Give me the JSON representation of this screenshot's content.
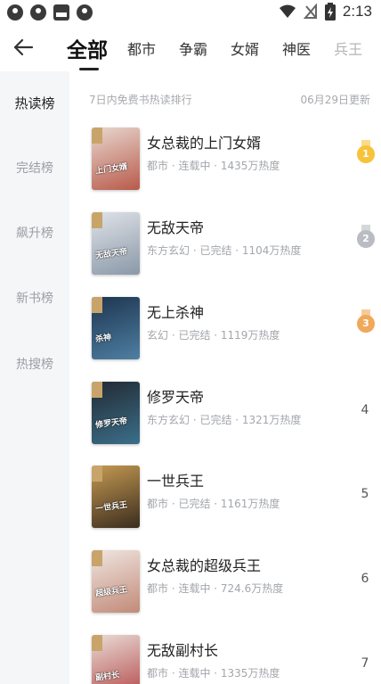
{
  "status_bar": {
    "time": "2:13"
  },
  "header": {
    "tabs": [
      {
        "label": "全部",
        "active": true
      },
      {
        "label": "都市"
      },
      {
        "label": "争霸"
      },
      {
        "label": "女婿"
      },
      {
        "label": "神医"
      },
      {
        "label": "兵王",
        "faded": true
      }
    ]
  },
  "sidebar": {
    "items": [
      {
        "label": "热读榜",
        "active": true
      },
      {
        "label": "完结榜"
      },
      {
        "label": "飙升榜"
      },
      {
        "label": "新书榜"
      },
      {
        "label": "热搜榜"
      }
    ]
  },
  "list": {
    "subtitle": "7日内免费书热读排行",
    "updated": "06月29日更新",
    "books": [
      {
        "title": "女总裁的上门女婿",
        "meta": "都市 · 连载中 · 1435万热度",
        "rank": "1",
        "cover_text": "上门女婿",
        "colors": [
          "#e8d7cf",
          "#b85a4a"
        ]
      },
      {
        "title": "无敌天帝",
        "meta": "东方玄幻 · 已完结 · 1104万热度",
        "rank": "2",
        "cover_text": "无敌天帝",
        "colors": [
          "#dfe3e8",
          "#8a98a8"
        ]
      },
      {
        "title": "无上杀神",
        "meta": "玄幻 · 已完结 · 1119万热度",
        "rank": "3",
        "cover_text": "杀神",
        "colors": [
          "#1d3550",
          "#4f7fa3"
        ]
      },
      {
        "title": "修罗天帝",
        "meta": "东方玄幻 · 已完结 · 1321万热度",
        "rank": "4",
        "cover_text": "修罗天帝",
        "colors": [
          "#222a33",
          "#3b6f8a"
        ]
      },
      {
        "title": "一世兵王",
        "meta": "都市 · 已完结 · 1161万热度",
        "rank": "5",
        "cover_text": "一世兵王",
        "colors": [
          "#c59a52",
          "#3a2c1e"
        ]
      },
      {
        "title": "女总裁的超级兵王",
        "meta": "都市 · 连载中 · 724.6万热度",
        "rank": "6",
        "cover_text": "超级兵王",
        "colors": [
          "#efe6e0",
          "#c28a78"
        ]
      },
      {
        "title": "无敌副村长",
        "meta": "都市 · 连载中 · 1335万热度",
        "rank": "7",
        "cover_text": "副村长",
        "colors": [
          "#e9dcd6",
          "#b44a4a"
        ]
      }
    ]
  },
  "colors": {
    "gold": "#f6c33a",
    "silver": "#b9bcc2",
    "bronze": "#f0a85a",
    "sidebar_bg": "#f5f6f8"
  }
}
